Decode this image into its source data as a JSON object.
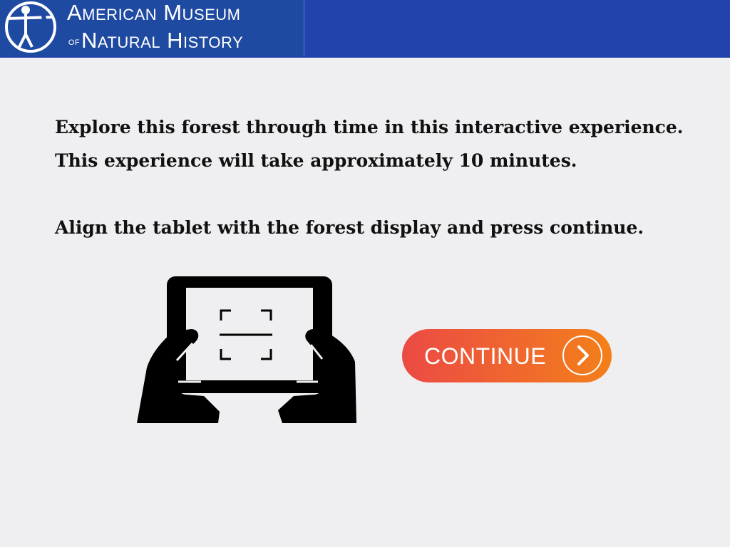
{
  "header": {
    "logo_line1": "American Museum",
    "logo_of": "of",
    "logo_line2": "Natural History",
    "logo_icon": "museum-figure-logo"
  },
  "main": {
    "line1": "Explore this forest through time in this interactive experience.",
    "line2": "This experience will take approximately 10 minutes.",
    "line3": "Align the tablet with the forest display and press continue.",
    "illustration_icon": "hands-holding-tablet-icon",
    "continue_label": "CONTINUE",
    "continue_icon": "chevron-right-icon"
  },
  "colors": {
    "header_bg": "#2143ab",
    "page_bg": "#efeff1",
    "button_gradient_start": "#ec4a44",
    "button_gradient_end": "#f38019"
  }
}
